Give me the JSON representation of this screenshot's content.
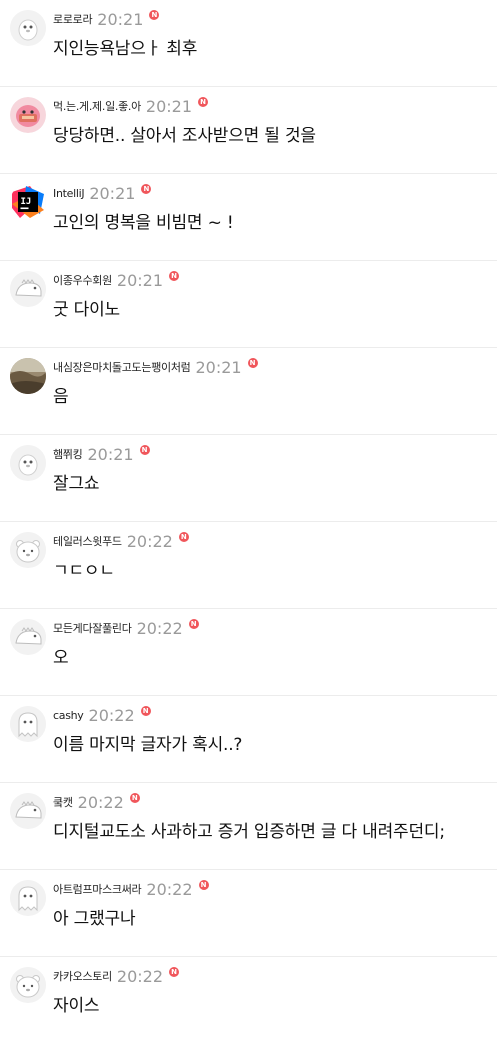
{
  "comments": [
    {
      "avatar": "penguin-avatar-icon",
      "nickname": "로로로라",
      "time": "20:21",
      "badge": "N",
      "text": "지인능욕남으ㅏ 최후"
    },
    {
      "avatar": "pink-character-avatar-icon",
      "nickname": "먹.는.게.제.일.좋.아",
      "time": "20:21",
      "badge": "N",
      "text": "당당하면.. 살아서 조사받으면 될 것을"
    },
    {
      "avatar": "intellij-logo-avatar-icon",
      "nickname": "IntelliJ",
      "time": "20:21",
      "badge": "N",
      "text": "고인의 명복을 비빔면 ~ !"
    },
    {
      "avatar": "dino-avatar-icon",
      "nickname": "이종우수회원",
      "time": "20:21",
      "badge": "N",
      "text": "굿 다이노"
    },
    {
      "avatar": "landscape-photo-avatar-icon",
      "nickname": "내심장은마치돌고도는팽이처럼",
      "time": "20:21",
      "badge": "N",
      "text": "음"
    },
    {
      "avatar": "penguin-avatar-icon",
      "nickname": "햄쮜킹",
      "time": "20:21",
      "badge": "N",
      "text": "잘그쇼"
    },
    {
      "avatar": "snowbear-avatar-icon",
      "nickname": "테일러스윗푸드",
      "time": "20:22",
      "badge": "N",
      "text": "ㄱㄷㅇㄴ"
    },
    {
      "avatar": "dino-avatar-icon",
      "nickname": "모든게다잘풀린다",
      "time": "20:22",
      "badge": "N",
      "text": "오"
    },
    {
      "avatar": "ghost-avatar-icon",
      "nickname": "cashy",
      "time": "20:22",
      "badge": "N",
      "text": "이름 마지막 글자가 혹시..?"
    },
    {
      "avatar": "dino-avatar-icon",
      "nickname": "쿸캣",
      "time": "20:22",
      "badge": "N",
      "text": "디지털교도소 사과하고 증거 입증하면 글 다 내려주던디;"
    },
    {
      "avatar": "ghost-avatar-icon",
      "nickname": "아트럼프마스크써라",
      "time": "20:22",
      "badge": "N",
      "text": "아 그랬구나"
    },
    {
      "avatar": "snowbear-avatar-icon",
      "nickname": "카카오스토리",
      "time": "20:22",
      "badge": "N",
      "text": "자이스"
    }
  ]
}
